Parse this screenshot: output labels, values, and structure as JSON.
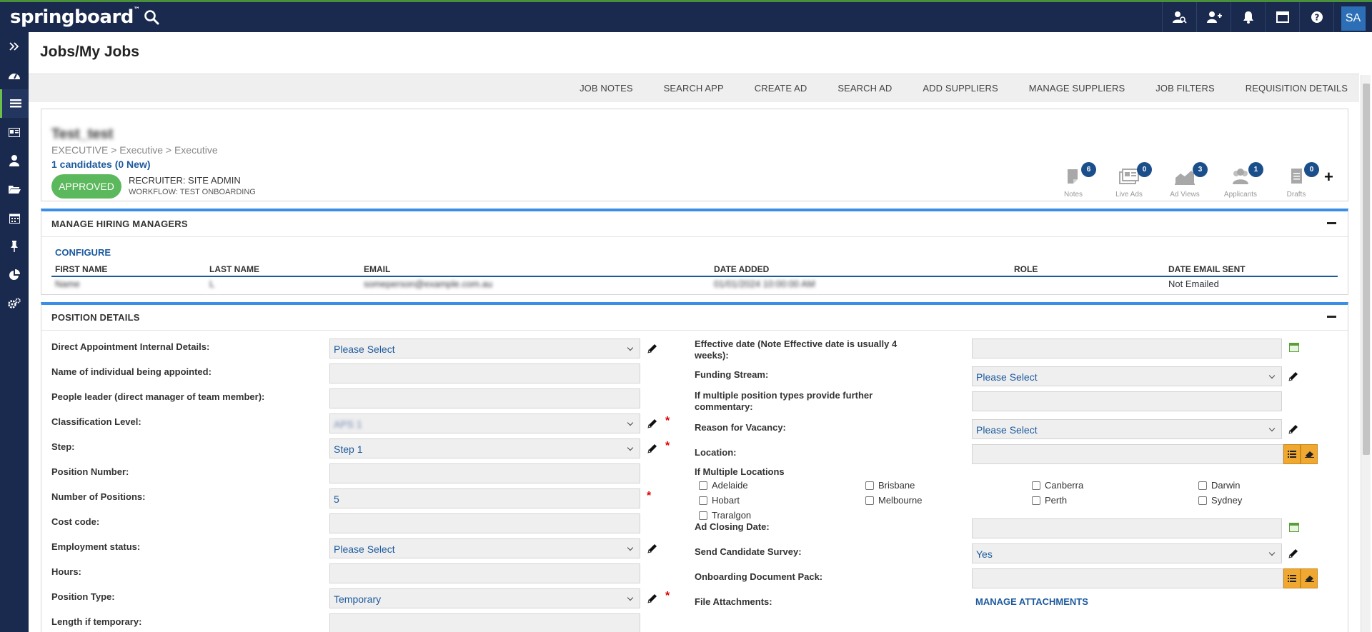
{
  "app": {
    "logo": "springboard",
    "user_initials": "SA"
  },
  "page": {
    "title": "Jobs/My Jobs"
  },
  "actions": [
    "JOB NOTES",
    "SEARCH APP",
    "CREATE AD",
    "SEARCH AD",
    "ADD SUPPLIERS",
    "MANAGE SUPPLIERS",
    "JOB FILTERS",
    "REQUISITION DETAILS"
  ],
  "job": {
    "name": "Test_test",
    "path": "EXECUTIVE > Executive > Executive",
    "candidates": "1 candidates (0 New)",
    "status": "APPROVED",
    "recruiter": "RECRUITER: SITE ADMIN",
    "workflow": "WORKFLOW: TEST ONBOARDING",
    "stats": [
      {
        "label": "Notes",
        "count": "6",
        "icon": "notes-icon"
      },
      {
        "label": "Live Ads",
        "count": "0",
        "icon": "live-ads-icon"
      },
      {
        "label": "Ad Views",
        "count": "3",
        "icon": "ad-views-icon"
      },
      {
        "label": "Applicants",
        "count": "1",
        "icon": "applicants-icon"
      },
      {
        "label": "Drafts",
        "count": "0",
        "icon": "drafts-icon"
      }
    ],
    "plus": "+"
  },
  "hiring_managers": {
    "title": "MANAGE HIRING MANAGERS",
    "configure": "CONFIGURE",
    "columns": [
      "FIRST NAME",
      "LAST NAME",
      "EMAIL",
      "DATE ADDED",
      "ROLE",
      "DATE EMAIL SENT"
    ],
    "rows": [
      {
        "first": "Name",
        "last": "L",
        "email": "someperson@example.com.au",
        "date_added": "01/01/2024 10:00:00 AM",
        "role": "",
        "email_sent": "Not Emailed"
      }
    ]
  },
  "position": {
    "title": "POSITION DETAILS",
    "left": [
      {
        "label": "Direct Appointment Internal Details:",
        "value": "Please Select",
        "type": "select",
        "pencil": true,
        "required": false
      },
      {
        "label": "Name of individual being appointed:",
        "value": "",
        "type": "text",
        "pencil": false,
        "required": false
      },
      {
        "label": "People leader (direct manager of team member):",
        "value": "",
        "type": "text",
        "pencil": false,
        "required": false
      },
      {
        "label": "Classification Level:",
        "value": "APS 1",
        "type": "select",
        "pencil": true,
        "required": true,
        "blur": true
      },
      {
        "label": "Step:",
        "value": "Step 1",
        "type": "select",
        "pencil": true,
        "required": true
      },
      {
        "label": "Position Number:",
        "value": "",
        "type": "text",
        "pencil": false,
        "required": false
      },
      {
        "label": "Number of Positions:",
        "value": "5",
        "type": "text",
        "pencil": false,
        "required": true
      },
      {
        "label": "Cost code:",
        "value": "",
        "type": "text",
        "pencil": false,
        "required": false
      },
      {
        "label": "Employment status:",
        "value": "Please Select",
        "type": "select",
        "pencil": true,
        "required": false
      },
      {
        "label": "Hours:",
        "value": "",
        "type": "text",
        "pencil": false,
        "required": false
      },
      {
        "label": "Position Type:",
        "value": "Temporary",
        "type": "select",
        "pencil": true,
        "required": true
      },
      {
        "label": "Length if temporary:",
        "value": "",
        "type": "text",
        "pencil": false,
        "required": false
      }
    ],
    "right": {
      "effective_date_label": "Effective date (Note Effective date is usually 4 weeks):",
      "funding_label": "Funding Stream:",
      "funding_value": "Please Select",
      "multiple_types_label": "If multiple position types provide further commentary:",
      "vacancy_label": "Reason for Vacancy:",
      "vacancy_value": "Please Select",
      "location_label": "Location:",
      "multi_loc_label": "If Multiple Locations",
      "locations": [
        "Adelaide",
        "Brisbane",
        "Canberra",
        "Darwin",
        "Hobart",
        "Melbourne",
        "Perth",
        "Sydney",
        "Traralgon"
      ],
      "ad_closing_label": "Ad Closing Date:",
      "survey_label": "Send Candidate Survey:",
      "survey_value": "Yes",
      "onboarding_label": "Onboarding Document Pack:",
      "attachments_label": "File Attachments:",
      "attachments_link": "MANAGE ATTACHMENTS"
    }
  }
}
